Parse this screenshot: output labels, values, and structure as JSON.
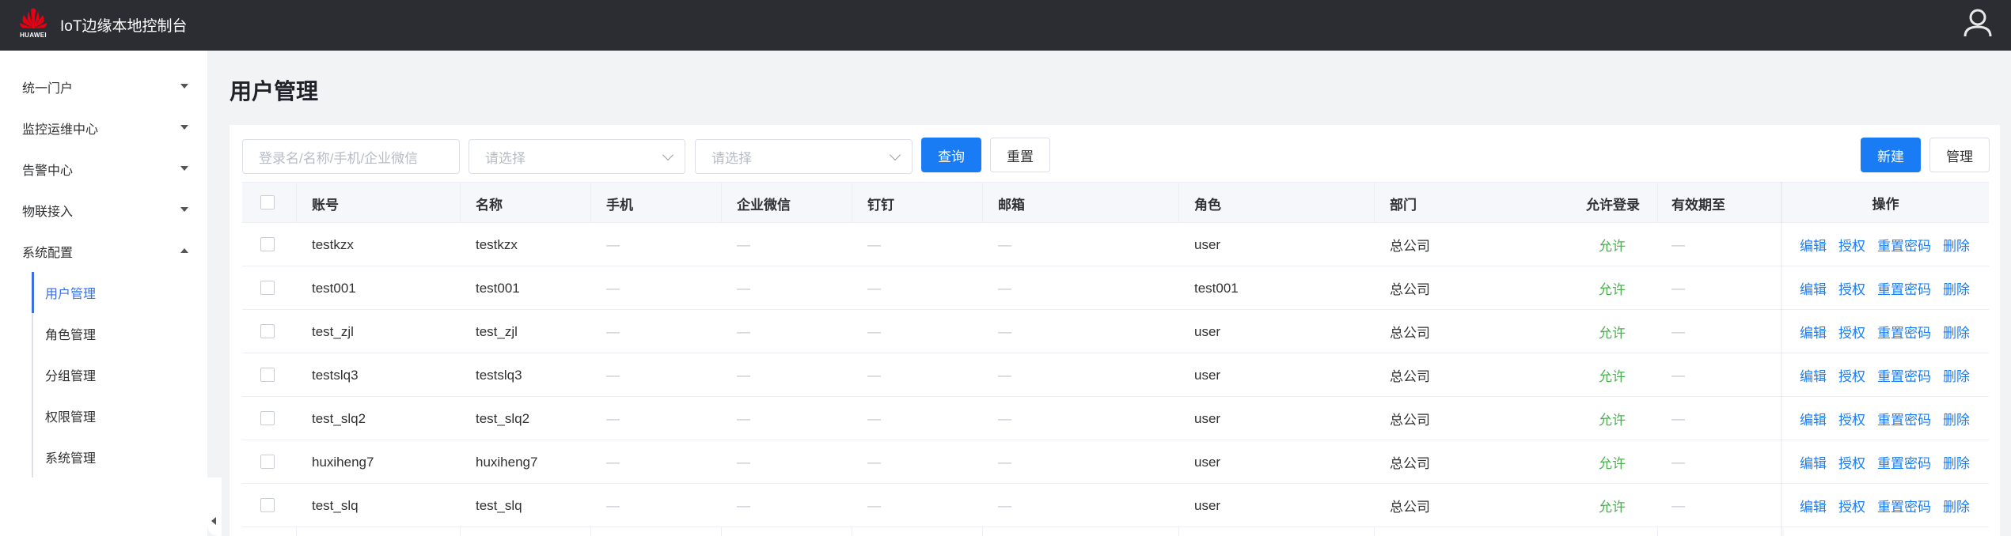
{
  "header": {
    "app_title": "IoT边缘本地控制台",
    "logo_text": "HUAWEI",
    "brand_color": "#e60012"
  },
  "sidebar": {
    "menus": [
      {
        "label": "统一门户",
        "expanded": false
      },
      {
        "label": "监控运维中心",
        "expanded": false
      },
      {
        "label": "告警中心",
        "expanded": false
      },
      {
        "label": "物联接入",
        "expanded": false
      },
      {
        "label": "系统配置",
        "expanded": true
      }
    ],
    "submenu": [
      {
        "label": "用户管理",
        "active": true
      },
      {
        "label": "角色管理",
        "active": false
      },
      {
        "label": "分组管理",
        "active": false
      },
      {
        "label": "权限管理",
        "active": false
      },
      {
        "label": "系统管理",
        "active": false
      }
    ]
  },
  "page": {
    "title": "用户管理"
  },
  "filters": {
    "search_placeholder": "登录名/名称/手机/企业微信",
    "select1_placeholder": "请选择",
    "select2_placeholder": "请选择",
    "query_label": "查询",
    "reset_label": "重置",
    "new_label": "新建",
    "manage_label": "管理"
  },
  "table": {
    "headers": {
      "account": "账号",
      "name": "名称",
      "phone": "手机",
      "wecom": "企业微信",
      "dingtalk": "钉钉",
      "email": "邮箱",
      "role": "角色",
      "dept": "部门",
      "login": "允许登录",
      "expire": "有效期至",
      "ops": "操作"
    },
    "rows": [
      {
        "account": "testkzx",
        "name": "testkzx",
        "phone": "—",
        "wecom": "—",
        "dingtalk": "—",
        "email": "—",
        "role": "user",
        "dept": "总公司",
        "login": "允许",
        "expire": "—"
      },
      {
        "account": "test001",
        "name": "test001",
        "phone": "—",
        "wecom": "—",
        "dingtalk": "—",
        "email": "—",
        "role": "test001",
        "dept": "总公司",
        "login": "允许",
        "expire": "—"
      },
      {
        "account": "test_zjl",
        "name": "test_zjl",
        "phone": "—",
        "wecom": "—",
        "dingtalk": "—",
        "email": "—",
        "role": "user",
        "dept": "总公司",
        "login": "允许",
        "expire": "—"
      },
      {
        "account": "testslq3",
        "name": "testslq3",
        "phone": "—",
        "wecom": "—",
        "dingtalk": "—",
        "email": "—",
        "role": "user",
        "dept": "总公司",
        "login": "允许",
        "expire": "—"
      },
      {
        "account": "test_slq2",
        "name": "test_slq2",
        "phone": "—",
        "wecom": "—",
        "dingtalk": "—",
        "email": "—",
        "role": "user",
        "dept": "总公司",
        "login": "允许",
        "expire": "—"
      },
      {
        "account": "huxiheng7",
        "name": "huxiheng7",
        "phone": "—",
        "wecom": "—",
        "dingtalk": "—",
        "email": "—",
        "role": "user",
        "dept": "总公司",
        "login": "允许",
        "expire": "—"
      },
      {
        "account": "test_slq",
        "name": "test_slq",
        "phone": "—",
        "wecom": "—",
        "dingtalk": "—",
        "email": "—",
        "role": "user",
        "dept": "总公司",
        "login": "允许",
        "expire": "—"
      }
    ],
    "actions": {
      "edit": "编辑",
      "authorize": "授权",
      "reset_password": "重置密码",
      "delete": "删除"
    }
  },
  "colors": {
    "primary": "#1a7cf4",
    "allow_green": "#4caf50",
    "active_menu": "#3a6fe0"
  }
}
